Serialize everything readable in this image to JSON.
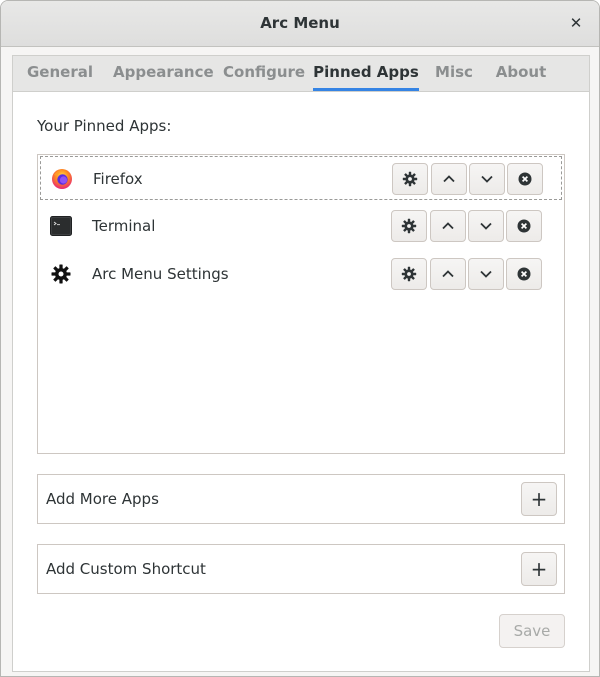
{
  "window": {
    "title": "Arc Menu",
    "close_glyph": "✕"
  },
  "tabs": [
    {
      "label": "General"
    },
    {
      "label": "Appearance"
    },
    {
      "label": "Configure"
    },
    {
      "label": "Pinned Apps",
      "active": true
    },
    {
      "label": "Misc"
    },
    {
      "label": "About"
    }
  ],
  "pinned": {
    "heading": "Your Pinned Apps:",
    "apps": [
      {
        "name": "Firefox",
        "icon": "firefox-icon"
      },
      {
        "name": "Terminal",
        "icon": "terminal-icon"
      },
      {
        "name": "Arc Menu Settings",
        "icon": "gear-icon"
      }
    ],
    "row_actions": [
      "gear-icon",
      "chevron-up-icon",
      "chevron-down-icon",
      "remove-icon"
    ]
  },
  "add_more_apps": {
    "label": "Add More Apps",
    "button_glyph": "+"
  },
  "add_custom_shortcut": {
    "label": "Add Custom Shortcut",
    "button_glyph": "+"
  },
  "save": {
    "label": "Save",
    "enabled": false
  },
  "colors": {
    "accent": "#3584e4",
    "text": "#2e3436",
    "inactive_tab": "#8b8e8f",
    "window_bg": "#f6f5f4"
  }
}
